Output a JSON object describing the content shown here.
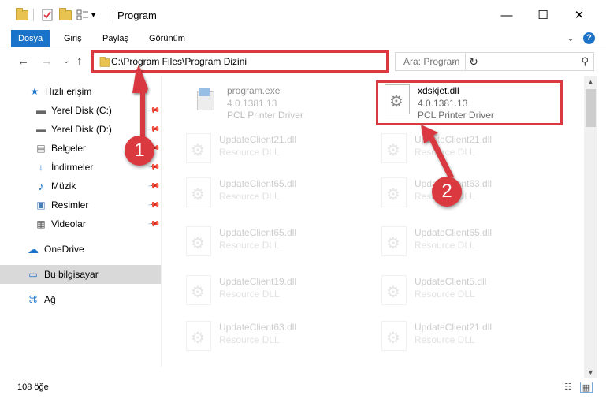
{
  "window": {
    "title": "Program",
    "minimize": "—",
    "maximize": "☐",
    "close": "✕"
  },
  "ribbon": {
    "tabs": [
      "Dosya",
      "Giriş",
      "Paylaş",
      "Görünüm"
    ],
    "expand": "⌄",
    "help": "?"
  },
  "nav": {
    "back": "←",
    "forward": "→",
    "recent": "⌄",
    "up": "↑",
    "address": "C:\\Program Files\\Program Dizini",
    "address_dropdown": "⌄",
    "refresh": "↻",
    "search_placeholder": "Ara: Program",
    "search_icon": "⚲"
  },
  "sidebar": {
    "items": [
      {
        "label": "Hızlı erişim",
        "icon": "★",
        "pinned": false
      },
      {
        "label": "Yerel Disk (C:)",
        "icon": "▬",
        "pinned": true
      },
      {
        "label": "Yerel Disk (D:)",
        "icon": "▬",
        "pinned": true
      },
      {
        "label": "Belgeler",
        "icon": "▤",
        "pinned": true
      },
      {
        "label": "İndirmeler",
        "icon": "↓",
        "pinned": true
      },
      {
        "label": "Müzik",
        "icon": "♪",
        "pinned": true
      },
      {
        "label": "Resimler",
        "icon": "▣",
        "pinned": true
      },
      {
        "label": "Videolar",
        "icon": "▦",
        "pinned": true
      },
      {
        "label": "OneDrive",
        "icon": "☁",
        "pinned": false
      },
      {
        "label": "Bu bilgisayar",
        "icon": "▭",
        "pinned": false
      },
      {
        "label": "Ağ",
        "icon": "⌘",
        "pinned": false
      }
    ],
    "pin_glyph": "📌"
  },
  "files": [
    {
      "name": "program.exe",
      "version": "4.0.1381.13",
      "desc": "PCL Printer Driver"
    },
    {
      "name": "xdskjet.dll",
      "version": "4.0.1381.13",
      "desc": "PCL Printer Driver"
    },
    {
      "name": "UpdateClient21.dll",
      "desc": "Resource DLL"
    },
    {
      "name": "UpdateClient21.dll",
      "desc": "Resource DLL"
    },
    {
      "name": "UpdateClient65.dll",
      "desc": "Resource DLL"
    },
    {
      "name": "UpdateClient63.dll",
      "desc": "Resource DLL"
    },
    {
      "name": "UpdateClient65.dll",
      "desc": "Resource DLL"
    },
    {
      "name": "UpdateClient65.dll",
      "desc": "Resource DLL"
    },
    {
      "name": "UpdateClient19.dll",
      "desc": "Resource DLL"
    },
    {
      "name": "UpdateClient5.dll",
      "desc": "Resource DLL"
    },
    {
      "name": "UpdateClient63.dll",
      "desc": "Resource DLL"
    },
    {
      "name": "UpdateClient21.dll",
      "desc": "Resource DLL"
    }
  ],
  "status": {
    "count": "108 öğe",
    "details_view": "☷",
    "icons_view": "▦"
  },
  "callouts": {
    "one": "1",
    "two": "2"
  },
  "colors": {
    "accent": "#1a73c8",
    "highlight": "#d9393f"
  }
}
